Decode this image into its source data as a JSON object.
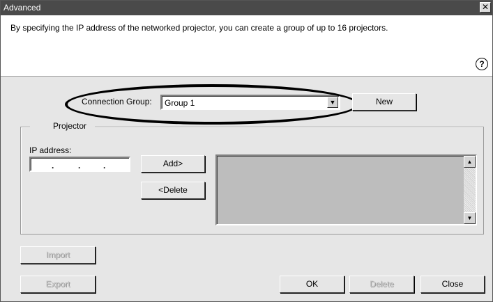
{
  "window": {
    "title": "Advanced",
    "close_glyph": "✕"
  },
  "header": {
    "description": "By specifying the IP address of the networked projector, you can create a group of up to 16 projectors.",
    "help_glyph": "?"
  },
  "connection_group": {
    "label": "Connection Group:",
    "selected": "Group 1",
    "arrow_glyph": "▼",
    "new_label": "New"
  },
  "projector": {
    "caption": "Projector",
    "ip_label": "IP address:",
    "ip_value": "   .   .   .",
    "add_label": "Add>",
    "delete_label": "<Delete",
    "list_items": [],
    "scroll_up_glyph": "▲",
    "scroll_down_glyph": "▼"
  },
  "footer": {
    "import_label": "Import",
    "export_label": "Export",
    "ok_label": "OK",
    "delete_label": "Delete",
    "close_label": "Close"
  }
}
